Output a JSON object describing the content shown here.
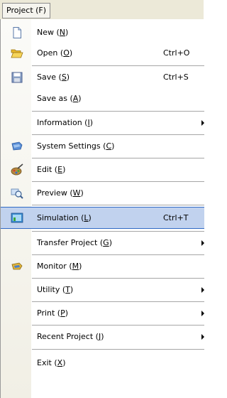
{
  "menubar": {
    "title": "Project (F)"
  },
  "menu": {
    "items": [
      {
        "id": "new",
        "label": "New",
        "mnemonic": "N",
        "shortcut": "",
        "icon": "new-document-icon"
      },
      {
        "id": "open",
        "label": "Open",
        "mnemonic": "O",
        "shortcut": "Ctrl+O",
        "icon": "open-folder-icon"
      },
      {
        "id": "save",
        "label": "Save",
        "mnemonic": "S",
        "shortcut": "Ctrl+S",
        "icon": "save-disk-icon"
      },
      {
        "id": "save-as",
        "label": "Save as",
        "mnemonic": "A",
        "shortcut": "",
        "icon": ""
      },
      {
        "id": "information",
        "label": "Information",
        "mnemonic": "I",
        "shortcut": "",
        "submenu": true,
        "icon": ""
      },
      {
        "id": "system-settings",
        "label": "System Settings",
        "mnemonic": "C",
        "shortcut": "",
        "icon": "settings-flag-icon"
      },
      {
        "id": "edit",
        "label": "Edit",
        "mnemonic": "E",
        "shortcut": "",
        "icon": "paint-palette-icon"
      },
      {
        "id": "preview",
        "label": "Preview",
        "mnemonic": "W",
        "shortcut": "",
        "icon": "magnifier-icon"
      },
      {
        "id": "simulation",
        "label": "Simulation",
        "mnemonic": "L",
        "shortcut": "Ctrl+T",
        "highlighted": true,
        "icon": "simulation-screen-icon"
      },
      {
        "id": "transfer-project",
        "label": "Transfer Project",
        "mnemonic": "G",
        "shortcut": "",
        "submenu": true,
        "icon": ""
      },
      {
        "id": "monitor",
        "label": "Monitor",
        "mnemonic": "M",
        "shortcut": "",
        "icon": "monitor-icon"
      },
      {
        "id": "utility",
        "label": "Utility",
        "mnemonic": "T",
        "shortcut": "",
        "submenu": true,
        "icon": ""
      },
      {
        "id": "print",
        "label": "Print",
        "mnemonic": "P",
        "shortcut": "",
        "submenu": true,
        "icon": ""
      },
      {
        "id": "recent-project",
        "label": "Recent Project",
        "mnemonic": "J",
        "shortcut": "",
        "submenu": true,
        "icon": ""
      },
      {
        "id": "exit",
        "label": "Exit",
        "mnemonic": "X",
        "shortcut": "",
        "icon": ""
      }
    ],
    "colors": {
      "highlight": "#c1d2ee",
      "highlight_border": "#316ac5"
    }
  }
}
